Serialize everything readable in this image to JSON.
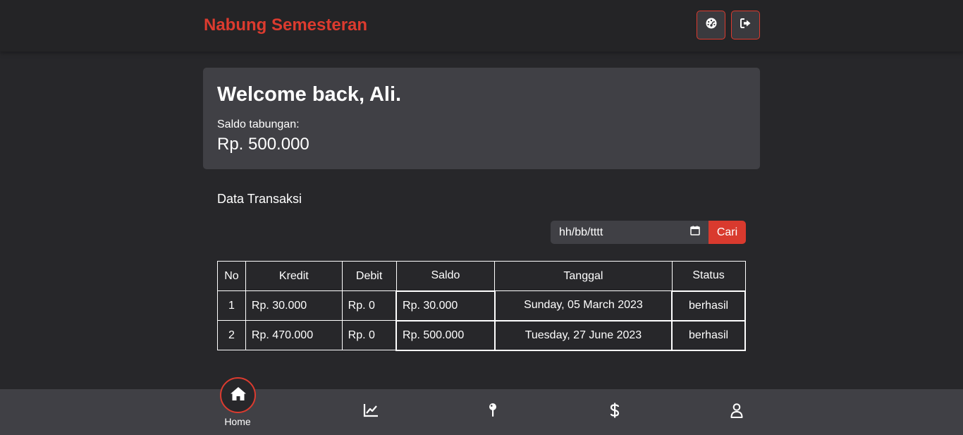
{
  "header": {
    "brand": "Nabung Semesteran",
    "dashboard_icon": "dashboard-gauge-icon",
    "logout_icon": "logout-icon",
    "accent_color": "#dc3b2f"
  },
  "welcome": {
    "title": "Welcome back, Ali.",
    "saldo_label": "Saldo tabungan:",
    "saldo_value": "Rp. 500.000"
  },
  "transactions": {
    "title": "Data Transaksi",
    "date_placeholder": "hh/bb/tttt",
    "search_label": "Cari",
    "columns": [
      "No",
      "Kredit",
      "Debit",
      "Saldo",
      "Tanggal",
      "Status"
    ],
    "rows": [
      [
        "1",
        "Rp. 30.000",
        "Rp. 0",
        "Rp. 30.000",
        "Sunday, 05 March 2023",
        "berhasil"
      ],
      [
        "2",
        "Rp. 470.000",
        "Rp. 0",
        "Rp. 500.000",
        "Tuesday, 27 June 2023",
        "berhasil"
      ]
    ]
  },
  "bottom_nav": {
    "home_label": "Home",
    "items": [
      "home-icon",
      "chart-line-icon",
      "pin-icon",
      "dollar-icon",
      "user-icon"
    ]
  }
}
